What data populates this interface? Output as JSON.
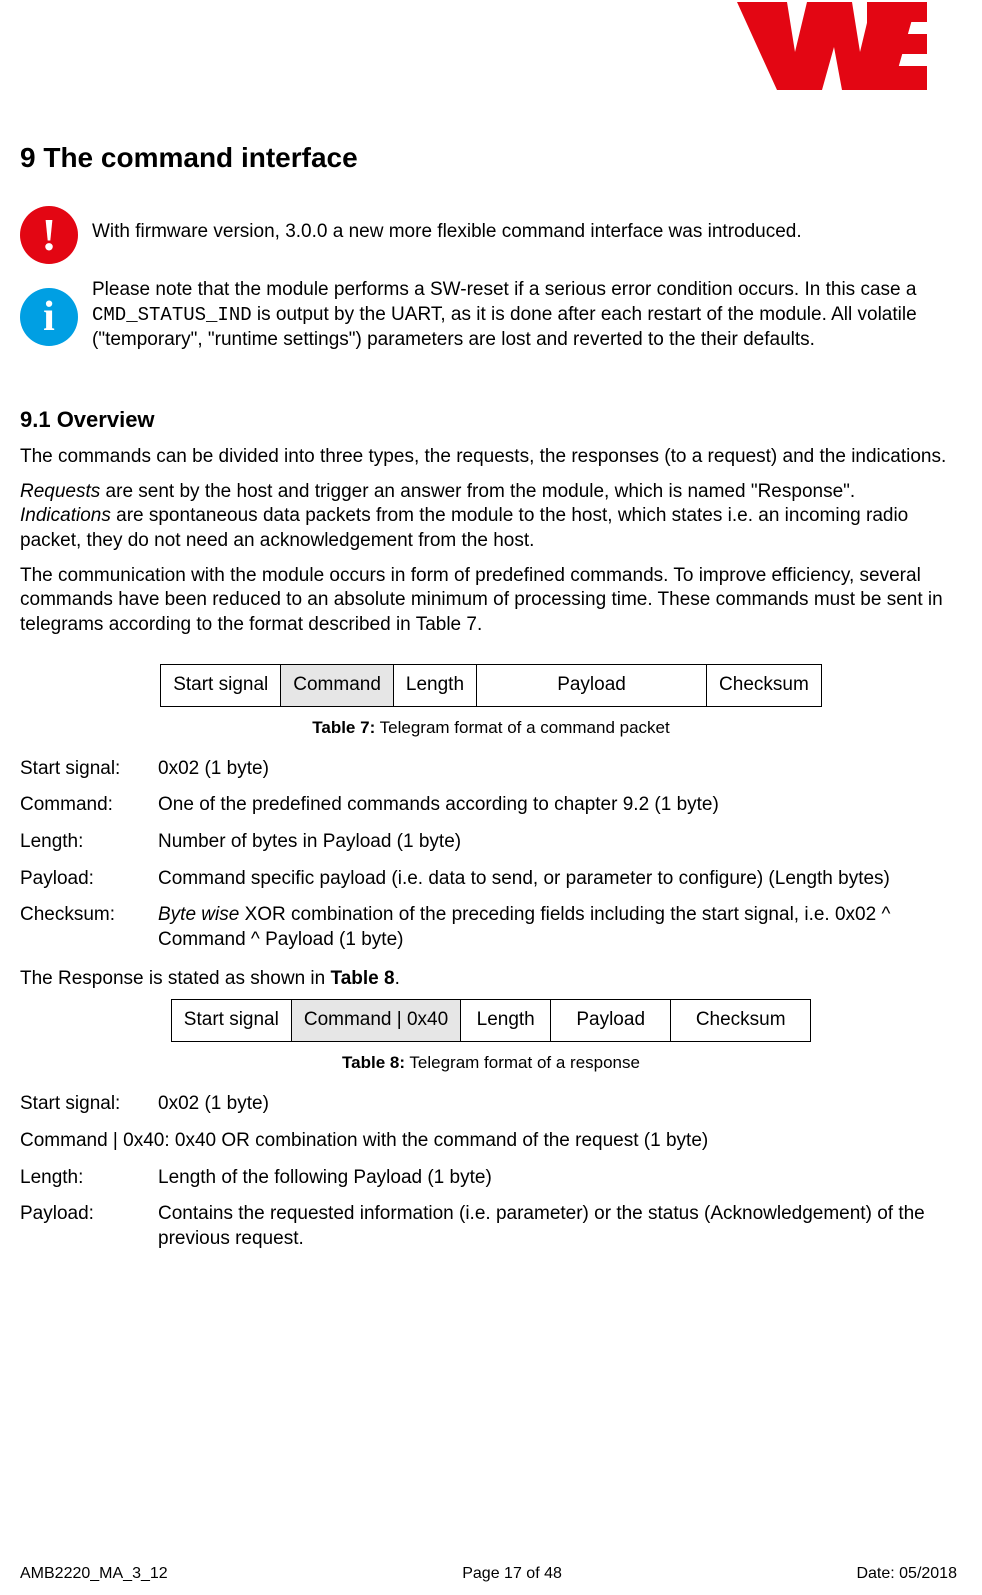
{
  "heading": "9 The command interface",
  "callout_warn": "With firmware version, 3.0.0 a new more flexible command interface was introduced.",
  "callout_info_a": "Please note that the module performs a SW-reset if a serious error condition occurs. In this case a ",
  "callout_info_code": "CMD_STATUS_IND",
  "callout_info_b": " is output by the UART, as it is done after each restart of the module. All volatile (\"temporary\", \"runtime settings\") parameters are lost and reverted to the their defaults.",
  "sub1": "9.1 Overview",
  "p1": "The commands can be divided into three types, the requests, the responses (to a request) and the indications.",
  "p2a": "Requests",
  "p2b": " are sent by the host and trigger an answer from the module, which is named \"Response\".",
  "p3a": "Indications",
  "p3b": " are spontaneous data packets from the module to the host, which states i.e. an incoming radio packet, they do not need an acknowledgement from the host.",
  "p4": "The communication with the module occurs in form of predefined commands. To improve efficiency, several commands have been reduced to an absolute minimum of processing time. These commands must be sent in telegrams according to the format described in Table 7.",
  "t7": {
    "c1": "Start signal",
    "c2": "Command",
    "c3": "Length",
    "c4": "Payload",
    "c5": "Checksum"
  },
  "t7cap_b": "Table 7:",
  "t7cap": " Telegram format of a command packet",
  "d1": {
    "t1": "Start signal:",
    "v1": "0x02 (1 byte)",
    "t2": "Command:",
    "v2": "One of the predefined commands according to chapter 9.2 (1 byte)",
    "t3": "Length:",
    "v3": "Number of bytes in Payload (1 byte)",
    "t4": "Payload:",
    "v4": "Command specific payload (i.e. data to send, or parameter to configure) (Length bytes)",
    "t5": "Checksum:",
    "v5a": "Byte wise",
    "v5b": " XOR combination of the preceding fields including the start signal, i.e. 0x02 ^ Command ^ Payload (1 byte)"
  },
  "respline_a": "The Response is stated as shown in ",
  "respline_b": "Table 8",
  "respline_c": ".",
  "t8": {
    "c1": "Start signal",
    "c2": "Command | 0x40",
    "c3": "Length",
    "c4": "Payload",
    "c5": "Checksum"
  },
  "t8cap_b": "Table 8:",
  "t8cap": " Telegram format of a response",
  "d2": {
    "t1": "Start signal:",
    "v1": "0x02 (1 byte)",
    "t2": "Command | 0x40: 0x40 OR combination with the command of the request (1 byte)",
    "t3": "Length:",
    "v3": "Length of the following Payload (1 byte)",
    "t4": "Payload:",
    "v4": "Contains the requested information (i.e. parameter) or the status (Acknowledgement) of the previous request."
  },
  "footer": {
    "left": "AMB2220_MA_3_12",
    "center": "Page 17 of 48",
    "right": "Date: 05/2018"
  }
}
